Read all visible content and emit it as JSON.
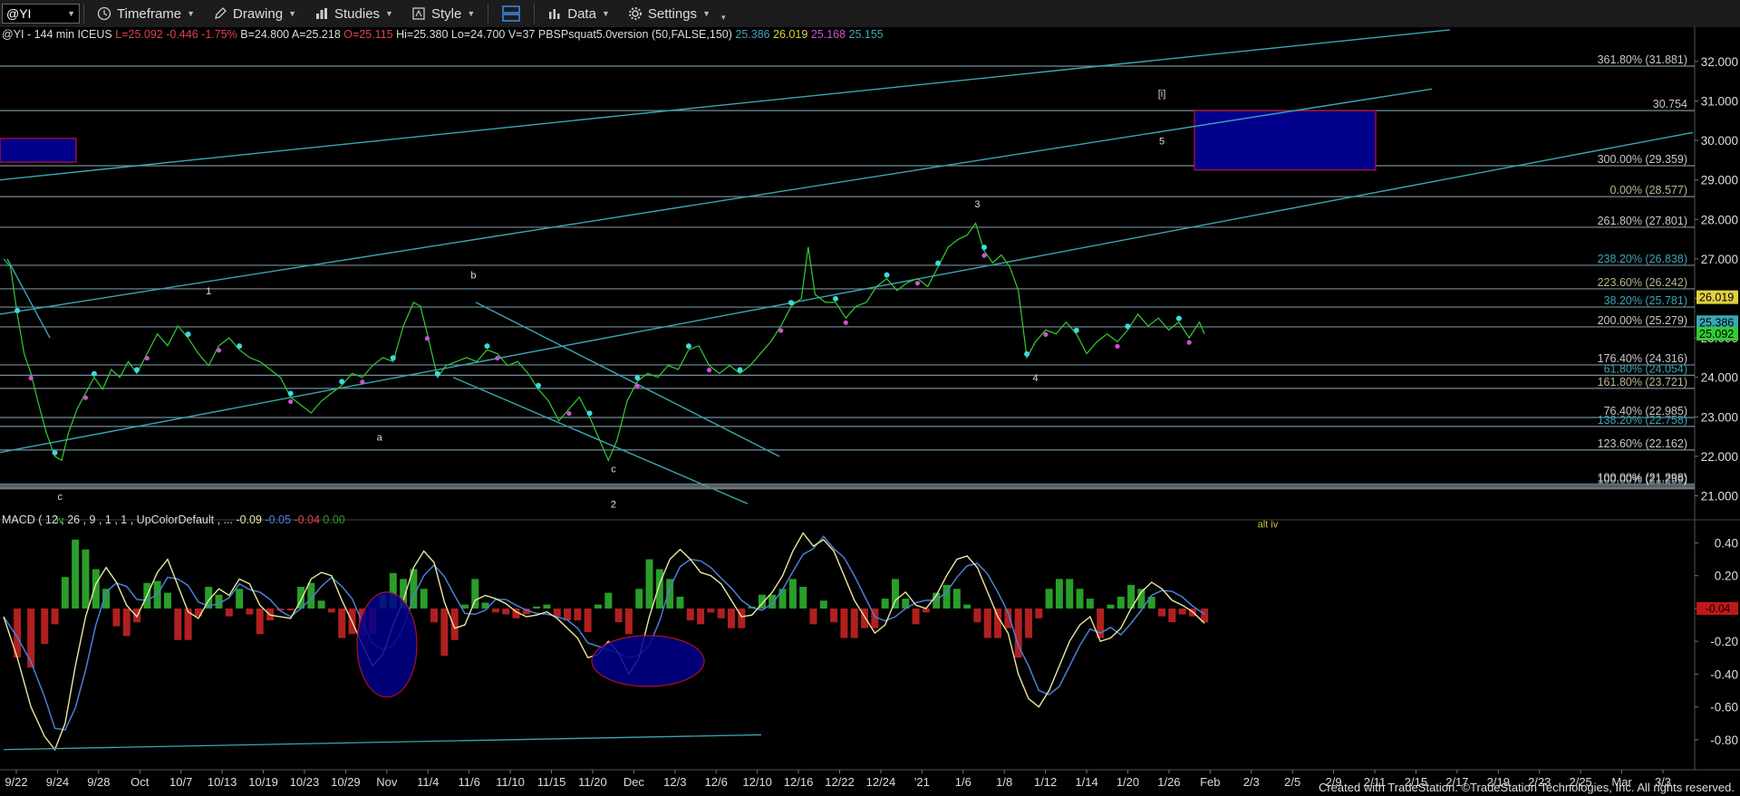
{
  "toolbar": {
    "symbol": "@YI",
    "timeframe": "Timeframe",
    "drawing": "Drawing",
    "studies": "Studies",
    "style": "Style",
    "data": "Data",
    "settings": "Settings"
  },
  "header": {
    "symbol_info": "@YI - 144 min  ICEUS",
    "last": "L=25.092",
    "change": "-0.446",
    "change_pct": "-1.75%",
    "bid": "B=24.800",
    "ask": "A=25.218",
    "open": "O=25.115",
    "high": "Hi=25.380",
    "low": "Lo=24.700",
    "volume": "V=37",
    "study": "PBSPsquat5.0version (50,FALSE,150)",
    "study_values": [
      "25.386",
      "26.019",
      "25.168",
      "25.155"
    ]
  },
  "macd_header": {
    "label": "MACD ( 12 , 26 , 9 , 1 , 1 , UpColorDefault , ...",
    "values": [
      "-0.09",
      "-0.05",
      "-0.04",
      "0.00"
    ]
  },
  "colors": {
    "price_up": "#33cc33",
    "accent": "#3ba5b5",
    "level_line": "#8aa6b8",
    "box_fill": "#00008b",
    "box_border": "#c01030",
    "macd_pos": "#2a9d2a",
    "macd_neg": "#b02020",
    "signal": "#4a7fd4",
    "macd_line": "#e8e8a0"
  },
  "chart_data": {
    "type": "line",
    "price_axis": {
      "ylim": [
        20.6,
        32.5
      ],
      "ticks": [
        "32.000",
        "31.000",
        "30.000",
        "29.000",
        "28.000",
        "27.000",
        "26.000",
        "25.000",
        "24.000",
        "23.000",
        "22.000",
        "21.000"
      ]
    },
    "macd_axis": {
      "ylim": [
        -0.9,
        0.48
      ],
      "ticks": [
        "0.40",
        "0.20",
        "0.00",
        "-0.20",
        "-0.40",
        "-0.60",
        "-0.80"
      ]
    },
    "x_ticks": [
      "9/22",
      "9/24",
      "9/28",
      "Oct",
      "10/7",
      "10/13",
      "10/19",
      "10/23",
      "10/29",
      "Nov",
      "11/4",
      "11/6",
      "11/10",
      "11/15",
      "11/20",
      "Dec",
      "12/3",
      "12/6",
      "12/10",
      "12/16",
      "12/22",
      "12/24",
      "'21",
      "1/6",
      "1/8",
      "1/12",
      "1/14",
      "1/20",
      "1/26",
      "Feb",
      "2/3",
      "2/5",
      "2/9",
      "2/11",
      "2/15",
      "2/17",
      "2/19",
      "2/23",
      "2/25",
      "Mar",
      "3/3"
    ],
    "fib_levels": [
      {
        "label": "361.80% (31.881)",
        "value": 31.881
      },
      {
        "label": "30.754",
        "value": 30.754
      },
      {
        "label": "300.00% (29.359)",
        "value": 29.359
      },
      {
        "label": "0.00% (28.577)",
        "value": 28.577
      },
      {
        "label": "261.80% (27.801)",
        "value": 27.801
      },
      {
        "label": "238.20% (26.838)",
        "value": 26.838
      },
      {
        "label": "223.60% (26.242)",
        "value": 26.242
      },
      {
        "label": "38.20% (25.781)",
        "value": 25.781
      },
      {
        "label": "200.00% (25.279)",
        "value": 25.279
      },
      {
        "label": "176.40% (24.316)",
        "value": 24.316
      },
      {
        "label": "61.80% (24.054)",
        "value": 24.054
      },
      {
        "label": "161.80% (23.721)",
        "value": 23.721
      },
      {
        "label": "76.40% (22.985)",
        "value": 22.985
      },
      {
        "label": "138.20% (22.758)",
        "value": 22.758
      },
      {
        "label": "123.60% (22.162)",
        "value": 22.162
      },
      {
        "label": "100.00% (21.298)",
        "value": 21.298
      },
      {
        "label": "100.00% (21.259)",
        "value": 21.259
      }
    ],
    "price_tags": [
      {
        "value": "26.019",
        "color": "#e0d040"
      },
      {
        "value": "25.386",
        "color": "#3ba5b5"
      },
      {
        "value": "25.092",
        "color": "#33cc33"
      }
    ],
    "price_series": [
      [
        0,
        27.0
      ],
      [
        0.4,
        26.8
      ],
      [
        0.8,
        25.6
      ],
      [
        1.2,
        24.6
      ],
      [
        1.6,
        24.1
      ],
      [
        2.0,
        23.4
      ],
      [
        2.5,
        22.6
      ],
      [
        3.0,
        22.0
      ],
      [
        3.4,
        21.9
      ],
      [
        3.8,
        22.6
      ],
      [
        4.3,
        23.2
      ],
      [
        4.8,
        23.6
      ],
      [
        5.3,
        24.0
      ],
      [
        5.8,
        23.7
      ],
      [
        6.3,
        24.2
      ],
      [
        6.8,
        24.0
      ],
      [
        7.3,
        24.4
      ],
      [
        7.8,
        24.1
      ],
      [
        8.4,
        24.6
      ],
      [
        9.0,
        25.1
      ],
      [
        9.6,
        24.8
      ],
      [
        10.2,
        25.3
      ],
      [
        10.8,
        25.0
      ],
      [
        11.4,
        24.6
      ],
      [
        12.0,
        24.3
      ],
      [
        12.6,
        24.8
      ],
      [
        13.2,
        25.0
      ],
      [
        13.8,
        24.7
      ],
      [
        14.4,
        24.5
      ],
      [
        15.0,
        24.4
      ],
      [
        15.6,
        24.2
      ],
      [
        16.2,
        24.0
      ],
      [
        16.8,
        23.5
      ],
      [
        17.4,
        23.3
      ],
      [
        18.0,
        23.1
      ],
      [
        18.6,
        23.4
      ],
      [
        19.2,
        23.6
      ],
      [
        19.8,
        23.8
      ],
      [
        20.4,
        24.1
      ],
      [
        21.0,
        24.0
      ],
      [
        21.6,
        24.3
      ],
      [
        22.2,
        24.5
      ],
      [
        22.8,
        24.4
      ],
      [
        23.4,
        25.3
      ],
      [
        24.0,
        25.9
      ],
      [
        24.4,
        25.8
      ],
      [
        24.8,
        25.1
      ],
      [
        25.4,
        24.0
      ],
      [
        25.9,
        24.3
      ],
      [
        26.5,
        24.4
      ],
      [
        27.1,
        24.5
      ],
      [
        27.7,
        24.4
      ],
      [
        28.3,
        24.7
      ],
      [
        28.9,
        24.6
      ],
      [
        29.5,
        24.3
      ],
      [
        30.1,
        24.4
      ],
      [
        30.7,
        24.1
      ],
      [
        31.3,
        23.7
      ],
      [
        31.9,
        23.4
      ],
      [
        32.5,
        22.9
      ],
      [
        33.1,
        23.2
      ],
      [
        33.7,
        23.5
      ],
      [
        34.3,
        23.0
      ],
      [
        34.9,
        22.4
      ],
      [
        35.4,
        21.9
      ],
      [
        35.9,
        22.4
      ],
      [
        36.5,
        23.4
      ],
      [
        37.1,
        23.9
      ],
      [
        37.7,
        24.1
      ],
      [
        38.3,
        24.0
      ],
      [
        38.9,
        24.3
      ],
      [
        39.5,
        24.2
      ],
      [
        40.1,
        24.7
      ],
      [
        40.7,
        24.8
      ],
      [
        41.3,
        24.3
      ],
      [
        41.9,
        24.1
      ],
      [
        42.5,
        24.3
      ],
      [
        43.1,
        24.1
      ],
      [
        43.7,
        24.3
      ],
      [
        44.3,
        24.6
      ],
      [
        44.9,
        24.9
      ],
      [
        45.5,
        25.3
      ],
      [
        46.1,
        25.8
      ],
      [
        46.7,
        26.0
      ],
      [
        47.1,
        27.3
      ],
      [
        47.5,
        26.1
      ],
      [
        48.1,
        25.9
      ],
      [
        48.7,
        25.9
      ],
      [
        49.3,
        25.5
      ],
      [
        49.9,
        25.8
      ],
      [
        50.5,
        25.9
      ],
      [
        51.1,
        26.3
      ],
      [
        51.7,
        26.5
      ],
      [
        52.3,
        26.2
      ],
      [
        52.9,
        26.4
      ],
      [
        53.5,
        26.5
      ],
      [
        54.1,
        26.3
      ],
      [
        54.7,
        26.8
      ],
      [
        55.3,
        27.3
      ],
      [
        55.9,
        27.5
      ],
      [
        56.4,
        27.6
      ],
      [
        56.9,
        27.9
      ],
      [
        57.4,
        27.2
      ],
      [
        57.9,
        26.9
      ],
      [
        58.4,
        27.1
      ],
      [
        58.9,
        26.8
      ],
      [
        59.4,
        26.2
      ],
      [
        59.9,
        24.5
      ],
      [
        60.4,
        24.9
      ],
      [
        61.0,
        25.2
      ],
      [
        61.6,
        25.1
      ],
      [
        62.2,
        25.4
      ],
      [
        62.8,
        25.1
      ],
      [
        63.4,
        24.6
      ],
      [
        64.0,
        24.9
      ],
      [
        64.6,
        25.1
      ],
      [
        65.2,
        24.9
      ],
      [
        65.8,
        25.2
      ],
      [
        66.4,
        25.6
      ],
      [
        67.0,
        25.3
      ],
      [
        67.6,
        25.5
      ],
      [
        68.2,
        25.2
      ],
      [
        68.8,
        25.4
      ],
      [
        69.4,
        25.0
      ],
      [
        70.0,
        25.4
      ],
      [
        70.3,
        25.1
      ]
    ],
    "macd_series": [
      [
        0,
        -0.05
      ],
      [
        0.8,
        -0.3
      ],
      [
        1.6,
        -0.6
      ],
      [
        2.4,
        -0.78
      ],
      [
        3.0,
        -0.86
      ],
      [
        3.6,
        -0.7
      ],
      [
        4.2,
        -0.35
      ],
      [
        4.8,
        -0.05
      ],
      [
        5.4,
        0.15
      ],
      [
        6.0,
        0.25
      ],
      [
        6.6,
        0.16
      ],
      [
        7.2,
        0.02
      ],
      [
        7.8,
        -0.05
      ],
      [
        8.4,
        0.08
      ],
      [
        9.0,
        0.22
      ],
      [
        9.6,
        0.3
      ],
      [
        10.2,
        0.14
      ],
      [
        10.8,
        -0.02
      ],
      [
        11.4,
        -0.06
      ],
      [
        12.0,
        0.05
      ],
      [
        12.6,
        0.12
      ],
      [
        13.2,
        0.08
      ],
      [
        13.8,
        0.18
      ],
      [
        14.4,
        0.15
      ],
      [
        15.0,
        0.02
      ],
      [
        15.6,
        -0.04
      ],
      [
        16.2,
        -0.05
      ],
      [
        16.8,
        -0.06
      ],
      [
        17.4,
        0.05
      ],
      [
        18.0,
        0.18
      ],
      [
        18.6,
        0.22
      ],
      [
        19.2,
        0.2
      ],
      [
        19.8,
        0.05
      ],
      [
        20.4,
        -0.08
      ],
      [
        21.0,
        -0.22
      ],
      [
        21.6,
        -0.35
      ],
      [
        22.2,
        -0.28
      ],
      [
        22.8,
        -0.1
      ],
      [
        23.4,
        0.05
      ],
      [
        24.0,
        0.25
      ],
      [
        24.6,
        0.35
      ],
      [
        25.2,
        0.28
      ],
      [
        25.8,
        0.04
      ],
      [
        26.4,
        -0.12
      ],
      [
        27.0,
        -0.1
      ],
      [
        27.6,
        0.05
      ],
      [
        28.2,
        0.08
      ],
      [
        28.8,
        0.06
      ],
      [
        29.4,
        0.03
      ],
      [
        30.0,
        -0.02
      ],
      [
        30.6,
        -0.05
      ],
      [
        31.2,
        -0.04
      ],
      [
        31.8,
        -0.02
      ],
      [
        32.4,
        -0.06
      ],
      [
        33.0,
        -0.12
      ],
      [
        33.6,
        -0.18
      ],
      [
        34.2,
        -0.3
      ],
      [
        34.8,
        -0.28
      ],
      [
        35.4,
        -0.2
      ],
      [
        36.0,
        -0.27
      ],
      [
        36.6,
        -0.4
      ],
      [
        37.2,
        -0.3
      ],
      [
        37.8,
        -0.05
      ],
      [
        38.4,
        0.15
      ],
      [
        39.0,
        0.3
      ],
      [
        39.6,
        0.36
      ],
      [
        40.2,
        0.3
      ],
      [
        40.8,
        0.22
      ],
      [
        41.4,
        0.2
      ],
      [
        42.0,
        0.15
      ],
      [
        42.6,
        0.05
      ],
      [
        43.2,
        -0.05
      ],
      [
        43.8,
        -0.04
      ],
      [
        44.4,
        0.03
      ],
      [
        45.0,
        0.1
      ],
      [
        45.6,
        0.2
      ],
      [
        46.2,
        0.35
      ],
      [
        46.8,
        0.46
      ],
      [
        47.4,
        0.38
      ],
      [
        48.0,
        0.42
      ],
      [
        48.6,
        0.35
      ],
      [
        49.2,
        0.2
      ],
      [
        49.8,
        0.05
      ],
      [
        50.4,
        -0.05
      ],
      [
        51.0,
        -0.15
      ],
      [
        51.6,
        -0.1
      ],
      [
        52.2,
        0.05
      ],
      [
        52.8,
        0.1
      ],
      [
        53.4,
        0.02
      ],
      [
        54.0,
        0.0
      ],
      [
        54.6,
        0.08
      ],
      [
        55.2,
        0.2
      ],
      [
        55.8,
        0.3
      ],
      [
        56.4,
        0.32
      ],
      [
        57.0,
        0.25
      ],
      [
        57.6,
        0.1
      ],
      [
        58.2,
        -0.05
      ],
      [
        58.8,
        -0.15
      ],
      [
        59.4,
        -0.4
      ],
      [
        60.0,
        -0.55
      ],
      [
        60.6,
        -0.6
      ],
      [
        61.2,
        -0.5
      ],
      [
        61.8,
        -0.35
      ],
      [
        62.4,
        -0.2
      ],
      [
        63.0,
        -0.1
      ],
      [
        63.6,
        -0.05
      ],
      [
        64.2,
        -0.2
      ],
      [
        64.8,
        -0.18
      ],
      [
        65.4,
        -0.12
      ],
      [
        66.0,
        0.0
      ],
      [
        66.6,
        0.1
      ],
      [
        67.2,
        0.16
      ],
      [
        67.8,
        0.12
      ],
      [
        68.4,
        0.05
      ],
      [
        69.0,
        0.02
      ],
      [
        69.6,
        -0.02
      ],
      [
        70.3,
        -0.09
      ]
    ],
    "wave_labels": [
      {
        "text": "c",
        "x": 3.3,
        "y": 20.9
      },
      {
        "text": "iv",
        "x": 3.3,
        "y": 20.3
      },
      {
        "text": "1",
        "x": 12.0,
        "y": 26.1
      },
      {
        "text": "a",
        "x": 22.0,
        "y": 22.4
      },
      {
        "text": "b",
        "x": 27.5,
        "y": 26.5
      },
      {
        "text": "c",
        "x": 35.7,
        "y": 21.6
      },
      {
        "text": "2",
        "x": 35.7,
        "y": 20.7
      },
      {
        "text": "3",
        "x": 57.0,
        "y": 28.3
      },
      {
        "text": "4",
        "x": 60.4,
        "y": 23.9
      },
      {
        "text": "[i]",
        "x": 67.8,
        "y": 31.1
      },
      {
        "text": "5",
        "x": 67.8,
        "y": 29.9
      },
      {
        "text": "alt iv",
        "x": 74.0,
        "y": 20.2
      }
    ]
  },
  "footer": "Created with TradeStation. ©TradeStation Technologies, Inc. All rights reserved."
}
